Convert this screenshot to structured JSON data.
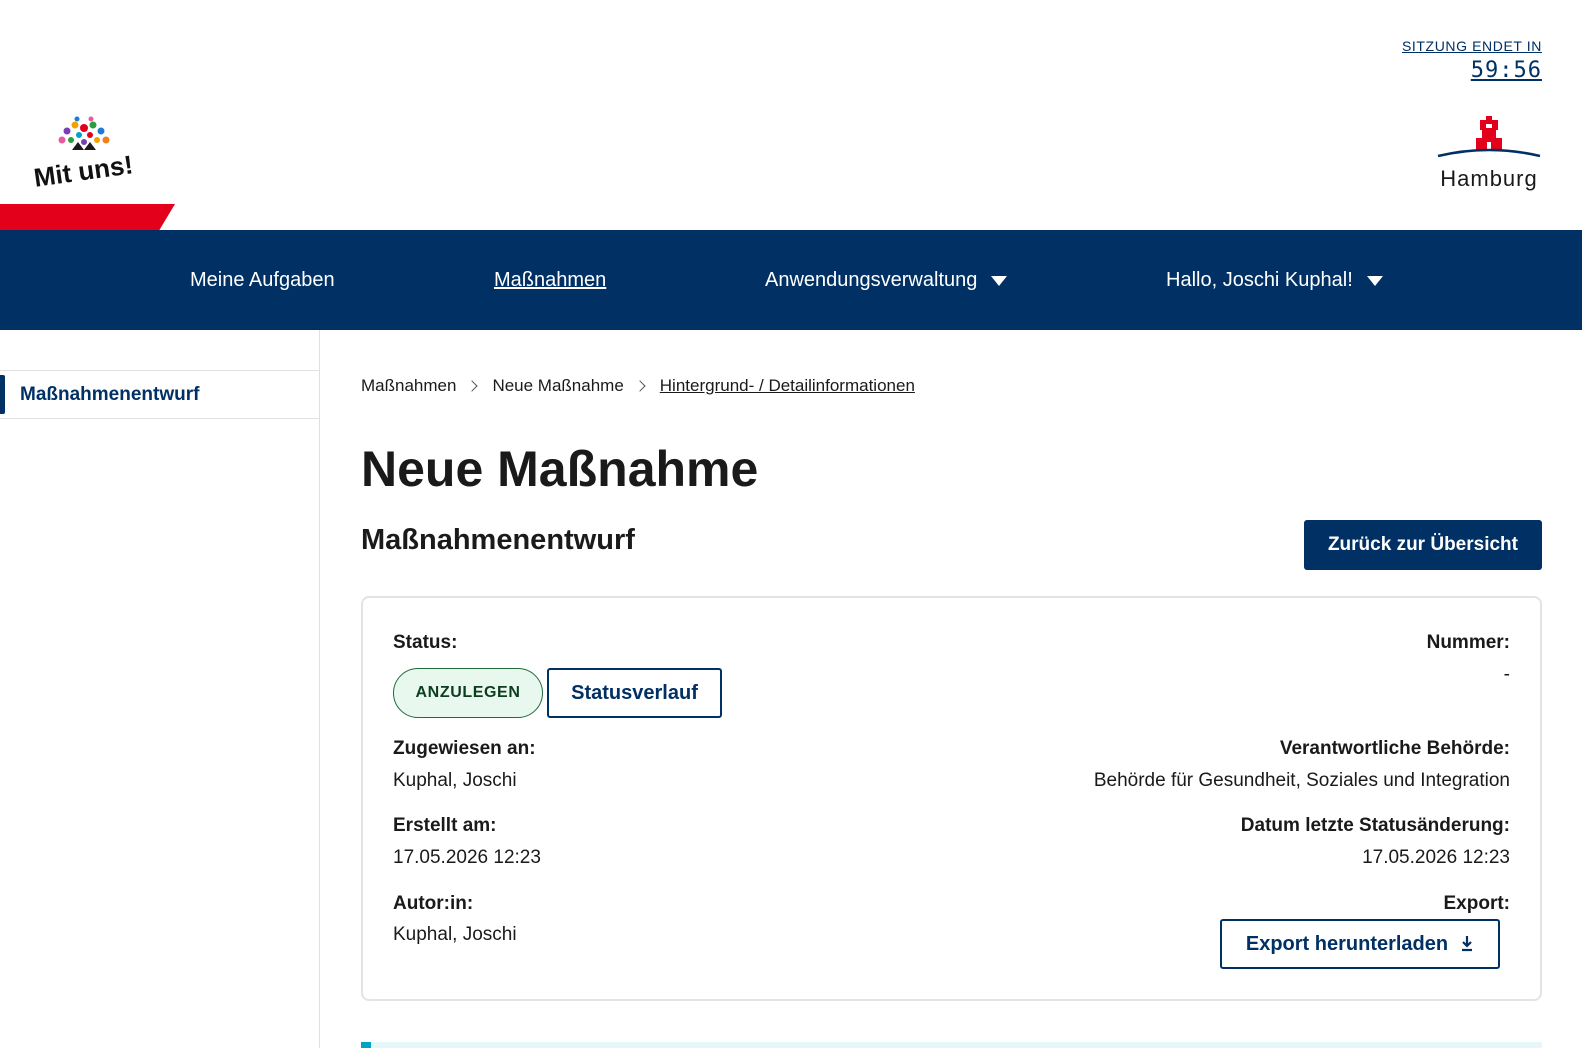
{
  "session": {
    "label": "SITZUNG ENDET IN",
    "timer": "59:56"
  },
  "logos": {
    "left_text": "Mit uns!",
    "right_text": "Hamburg"
  },
  "colors": {
    "primary": "#003064",
    "accent_red": "#e2001a",
    "badge_bg": "#e8f8ee",
    "badge_border": "#1f6b3a",
    "info_bar": "#00a3c4"
  },
  "nav": {
    "items": [
      {
        "label": "Meine Aufgaben"
      },
      {
        "label": "Maßnahmen",
        "active": true
      },
      {
        "label": "Anwendungsverwaltung",
        "icon": "caret-down-icon"
      },
      {
        "label": "Hallo, Joschi Kuphal!",
        "icon": "caret-down-icon"
      }
    ]
  },
  "sidebar": {
    "items": [
      {
        "label": "Maßnahmenentwurf",
        "active": true
      }
    ]
  },
  "breadcrumb": [
    "Maßnahmen",
    "Neue Maßnahme",
    "Hintergrund- / Detailinformationen"
  ],
  "page": {
    "title": "Neue Maßnahme",
    "section_title": "Maßnahmenentwurf",
    "back_button": "Zurück zur Übersicht"
  },
  "card": {
    "status_label": "Status:",
    "status_badge": "ANZULEGEN",
    "status_history_button": "Statusverlauf",
    "number_label": "Nummer:",
    "number_value": "-",
    "assigned_label": "Zugewiesen an:",
    "assigned_value": "Kuphal, Joschi",
    "authority_label": "Verantwortliche Behörde:",
    "authority_value": "Behörde für Gesundheit, Soziales und Integration",
    "created_label": "Erstellt am:",
    "created_value": "17.05.2026 12:23",
    "status_change_label": "Datum letzte Statusänderung:",
    "status_change_value": "17.05.2026 12:23",
    "author_label": "Autor:in:",
    "author_value": "Kuphal, Joschi",
    "export_label": "Export:",
    "export_button": "Export herunterladen",
    "export_icon": "download-icon"
  }
}
